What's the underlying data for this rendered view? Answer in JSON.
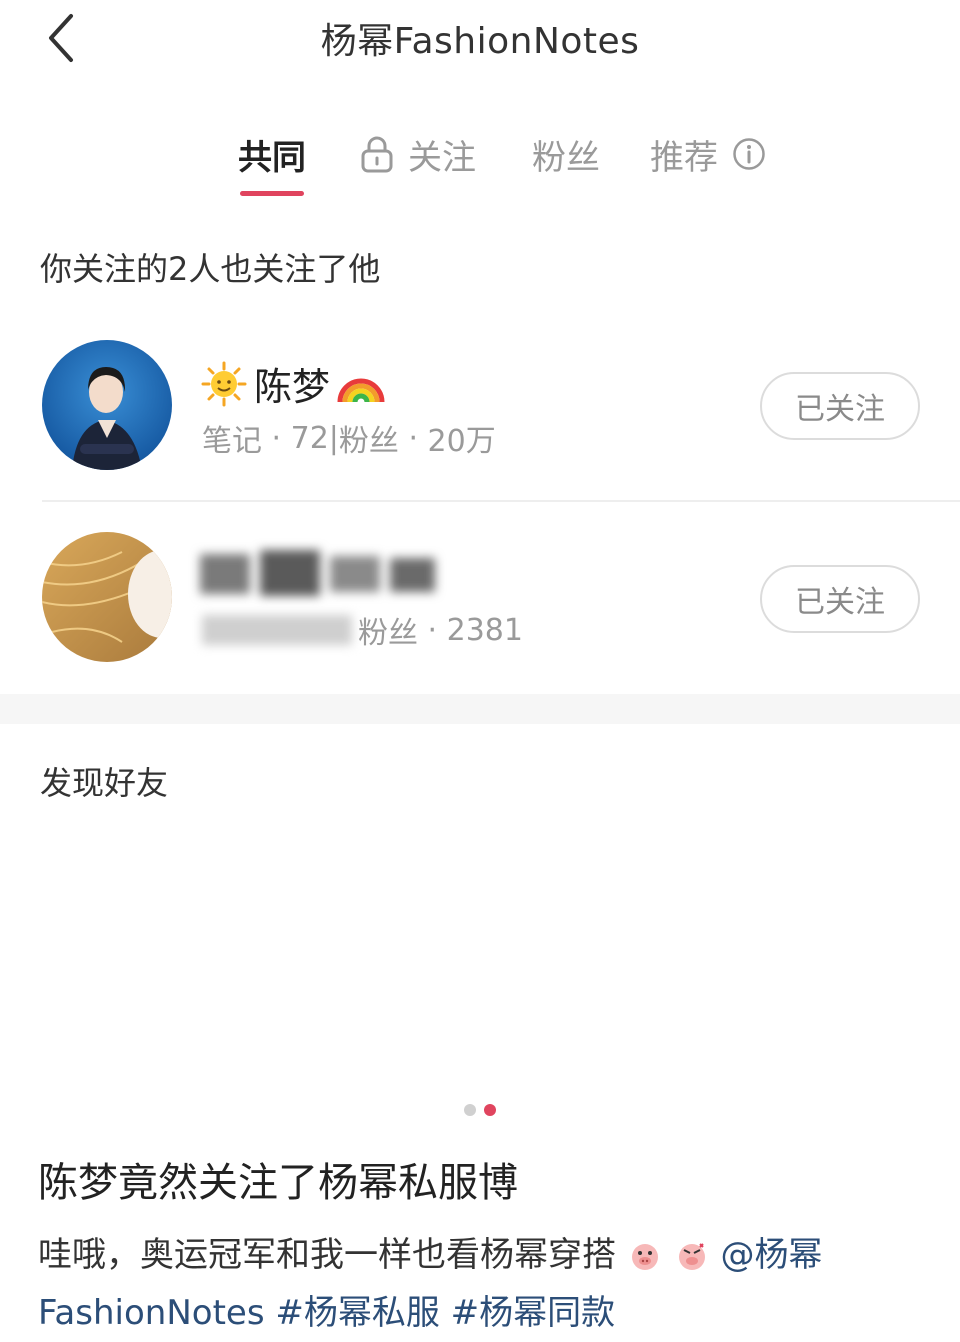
{
  "header": {
    "title": "杨幂FashionNotes"
  },
  "tabs": [
    {
      "label": "共同",
      "active": true
    },
    {
      "label": "关注",
      "locked": true
    },
    {
      "label": "粉丝"
    },
    {
      "label": "推荐",
      "info": true
    }
  ],
  "mutual": {
    "title": "你关注的2人也关注了他",
    "users": [
      {
        "name": "陈梦",
        "name_prefix_emoji": "sun-emoji",
        "name_suffix_emoji": "rainbow-emoji",
        "notes_label": "笔记",
        "notes": "72",
        "fans_label": "粉丝",
        "fans": "20万",
        "button": "已关注"
      },
      {
        "name": "",
        "fans_label": "粉丝",
        "fans": "2381",
        "button": "已关注"
      }
    ]
  },
  "discover": {
    "title": "发现好友"
  },
  "post": {
    "title": "陈梦竟然关注了杨幂私服博",
    "body_text": "哇哦，奥运冠军和我一样也看杨幂穿搭",
    "mention": "@杨幂FashionNotes",
    "tags": [
      "#杨幂私服",
      "#杨幂同款"
    ]
  },
  "colors": {
    "accent": "#e0445e",
    "link": "#2c4e78",
    "muted": "#9a9a9a"
  }
}
